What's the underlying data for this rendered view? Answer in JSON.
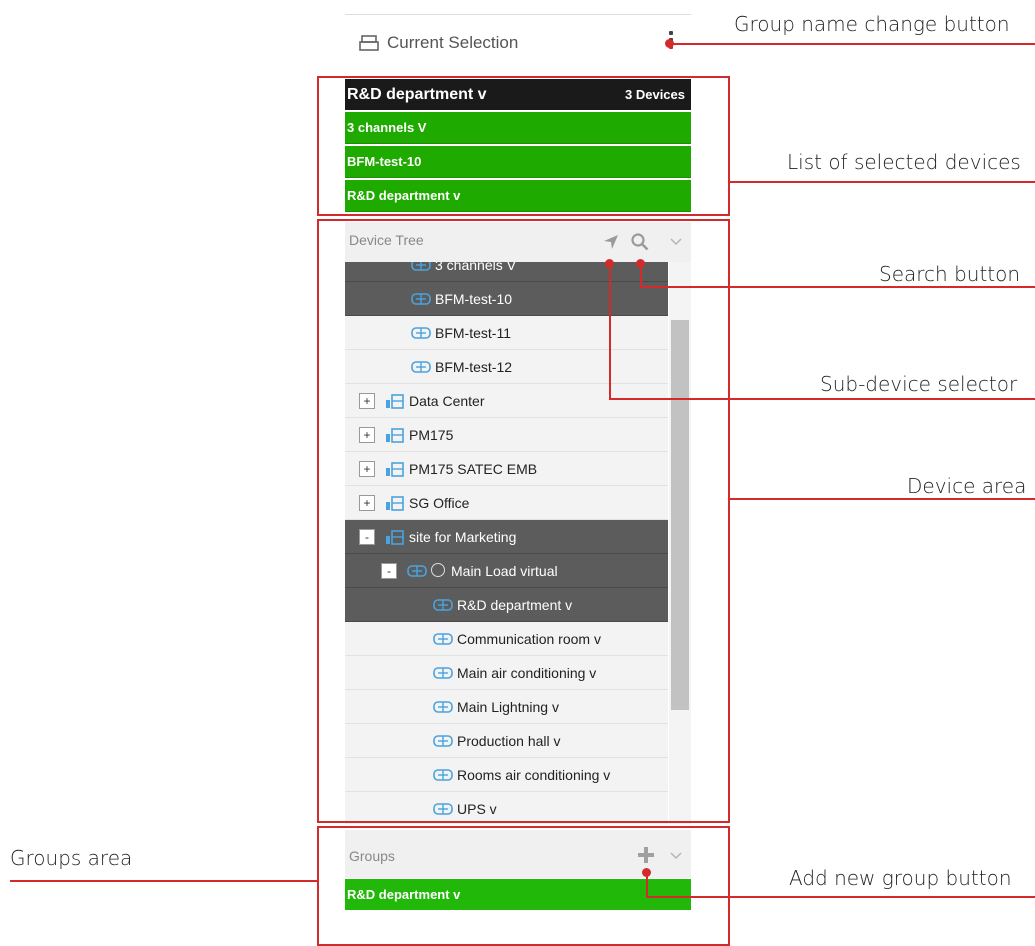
{
  "current_selection": {
    "title": "Current Selection"
  },
  "selected": {
    "header_name": "R&D department v",
    "header_count": "3 Devices",
    "items": [
      "3 channels V",
      "BFM-test-10",
      "R&D department v"
    ]
  },
  "tree": {
    "label": "Device Tree",
    "rows": [
      {
        "text": "3 channels V",
        "style": "dark",
        "indent": 1
      },
      {
        "text": "BFM-test-10",
        "style": "dark",
        "indent": 1
      },
      {
        "text": "BFM-test-11",
        "style": "light",
        "indent": 1
      },
      {
        "text": "BFM-test-12",
        "style": "light",
        "indent": 1
      },
      {
        "text": "Data Center",
        "style": "light",
        "indent": 0,
        "toggle": "+"
      },
      {
        "text": "PM175",
        "style": "light",
        "indent": 0,
        "toggle": "+"
      },
      {
        "text": "PM175 SATEC EMB",
        "style": "light",
        "indent": 0,
        "toggle": "+"
      },
      {
        "text": "SG Office",
        "style": "light",
        "indent": 0,
        "toggle": "+"
      },
      {
        "text": "site for Marketing",
        "style": "dark",
        "indent": 0,
        "toggle": "-"
      },
      {
        "text": "Main Load virtual",
        "style": "dark",
        "indent": 1,
        "toggle": "-",
        "radio": true
      },
      {
        "text": "R&D department v",
        "style": "dark",
        "indent": 2
      },
      {
        "text": "Communication room v",
        "style": "light",
        "indent": 2
      },
      {
        "text": "Main air conditioning v",
        "style": "light",
        "indent": 2
      },
      {
        "text": "Main Lightning v",
        "style": "light",
        "indent": 2
      },
      {
        "text": "Production hall v",
        "style": "light",
        "indent": 2
      },
      {
        "text": "Rooms air conditioning v",
        "style": "light",
        "indent": 2
      },
      {
        "text": "UPS v",
        "style": "light",
        "indent": 2
      }
    ]
  },
  "groups": {
    "label": "Groups",
    "items": [
      "R&D department v"
    ]
  },
  "callouts": {
    "group_name_change": "Group name change button",
    "list_selected": "List of selected devices",
    "search": "Search button",
    "sub_device": "Sub-device selector",
    "device_area": "Device area",
    "groups_area": "Groups area",
    "add_group": "Add new group button"
  },
  "colors": {
    "accent_red": "#d32b2b",
    "selected_green": "#1faa00",
    "dark_row": "#5c5c5c"
  }
}
